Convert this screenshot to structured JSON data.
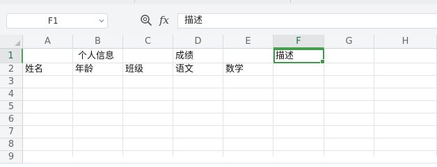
{
  "toolbar": {
    "name_box": "F1",
    "formula_label": "fx",
    "formula_value": "描述"
  },
  "columns": [
    "A",
    "B",
    "C",
    "D",
    "E",
    "F",
    "G",
    "H"
  ],
  "rows": [
    "1",
    "2",
    "3",
    "4",
    "5",
    "6",
    "7",
    "8",
    "9"
  ],
  "active_cell": {
    "column": "F",
    "row": "1"
  },
  "cells": {
    "B1": "个人信息",
    "D1": "成绩",
    "F1": "描述",
    "A2": "姓名",
    "B2": "年龄",
    "C2": "班级",
    "D2": "语文",
    "E2": "数学"
  },
  "colors": {
    "selection": "#3d9a47",
    "header_bg": "#f4f5f6",
    "toolbar_bg": "#f3f4f5",
    "gridline": "#e1e3e6"
  }
}
